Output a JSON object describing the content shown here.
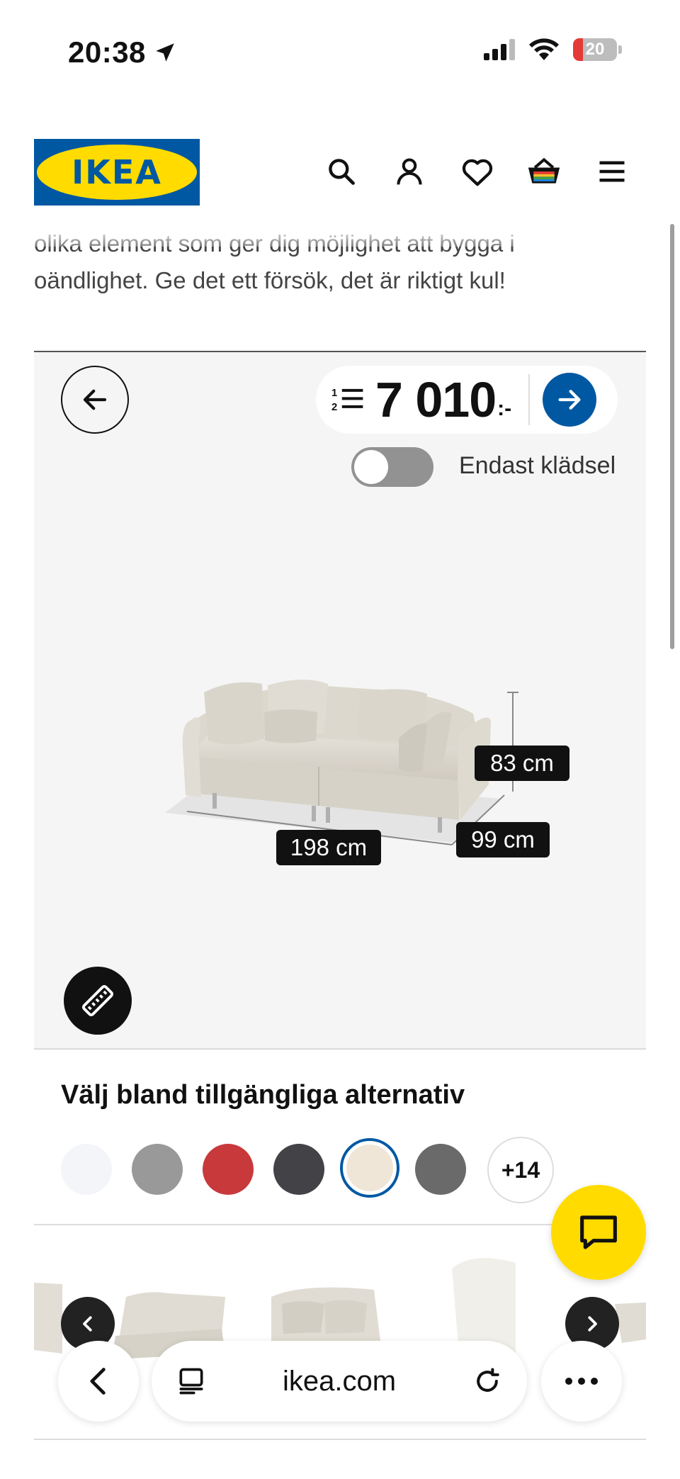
{
  "status_bar": {
    "time": "20:38",
    "battery": "20"
  },
  "header": {
    "logo_text": "IKEA"
  },
  "intro": {
    "line1": "olika element som ger dig möjlighet att bygga i",
    "line2": "oändlighet. Ge det ett försök, det är riktigt kul!"
  },
  "configurator": {
    "price": "7 010",
    "price_suffix": ":-",
    "toggle_label": "Endast klädsel",
    "toggle_on": false,
    "dimensions": {
      "height": "83 cm",
      "width": "198 cm",
      "depth": "99 cm"
    }
  },
  "options": {
    "title": "Välj bland tillgängliga alternativ",
    "swatches": [
      {
        "name": "white",
        "color": "#f3f5f9"
      },
      {
        "name": "grey",
        "color": "#999999"
      },
      {
        "name": "red",
        "color": "#c8393c"
      },
      {
        "name": "dark-grey",
        "color": "#434347"
      },
      {
        "name": "beige",
        "color": "#efe6d8",
        "selected": true
      },
      {
        "name": "medium-grey",
        "color": "#6a6a6a"
      }
    ],
    "more_label": "+14"
  },
  "browser": {
    "url": "ikea.com"
  },
  "colors": {
    "ikea_blue": "#0058a3",
    "ikea_yellow": "#ffdb00"
  }
}
